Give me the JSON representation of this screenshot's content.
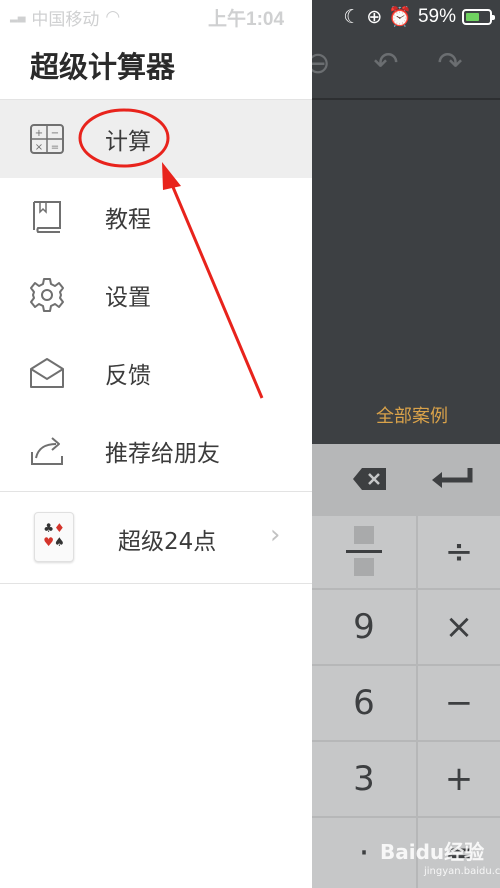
{
  "status_bar": {
    "carrier": "中国移动",
    "time": "上午1:04",
    "battery_text": "59%",
    "battery_level": 0.59
  },
  "drawer": {
    "title": "超级计算器",
    "items": [
      {
        "label": "计算",
        "icon": "calculator-icon",
        "active": true
      },
      {
        "label": "教程",
        "icon": "book-icon",
        "active": false
      },
      {
        "label": "设置",
        "icon": "gear-icon",
        "active": false
      },
      {
        "label": "反馈",
        "icon": "envelope-icon",
        "active": false
      },
      {
        "label": "推荐给朋友",
        "icon": "share-icon",
        "active": false
      }
    ],
    "game": {
      "label": "超级24点",
      "icon": "playing-cards-icon"
    }
  },
  "calculator": {
    "all_cases_label": "全部案例",
    "keys": {
      "fraction": "",
      "divide": "÷",
      "nine": "9",
      "multiply": "×",
      "six": "6",
      "minus": "−",
      "three": "3",
      "plus": "+",
      "dot": "·",
      "equals": "="
    }
  },
  "watermark": {
    "text": "Baidu经验",
    "sub": "jingyan.baidu.com"
  },
  "colors": {
    "accent_annotation": "#e8231c",
    "all_cases": "#d9a24a",
    "keypad_bg": "#b6b7b8",
    "calc_dark": "#3d4043"
  }
}
